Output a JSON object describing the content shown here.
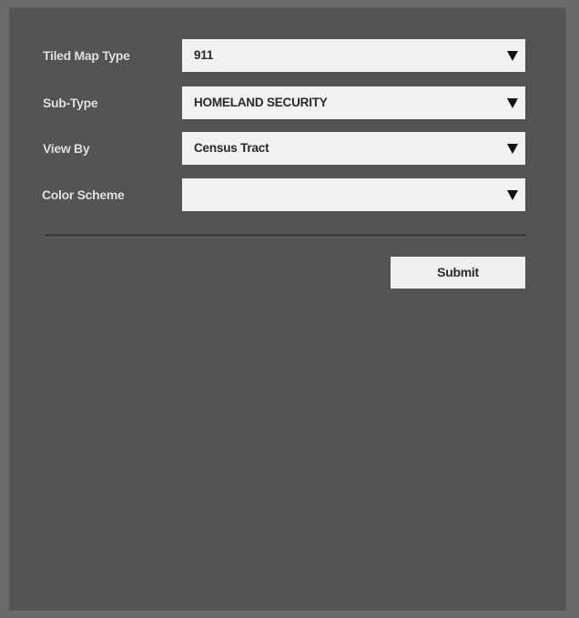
{
  "form": {
    "fields": [
      {
        "label": "Tiled Map Type",
        "value": "911"
      },
      {
        "label": "Sub-Type",
        "value": "HOMELAND SECURITY"
      },
      {
        "label": "View By",
        "value": "Census Tract"
      },
      {
        "label": "Color Scheme",
        "value": ""
      }
    ],
    "submit_label": "Submit"
  },
  "icons": {
    "dropdown_indicator": "chevron-down-icon"
  },
  "colors": {
    "page_background": "#6a6a6a",
    "panel_background": "#545454",
    "field_background": "#f1f1f1",
    "label_text": "#e2e2e2",
    "value_text": "#2a2a2a"
  }
}
